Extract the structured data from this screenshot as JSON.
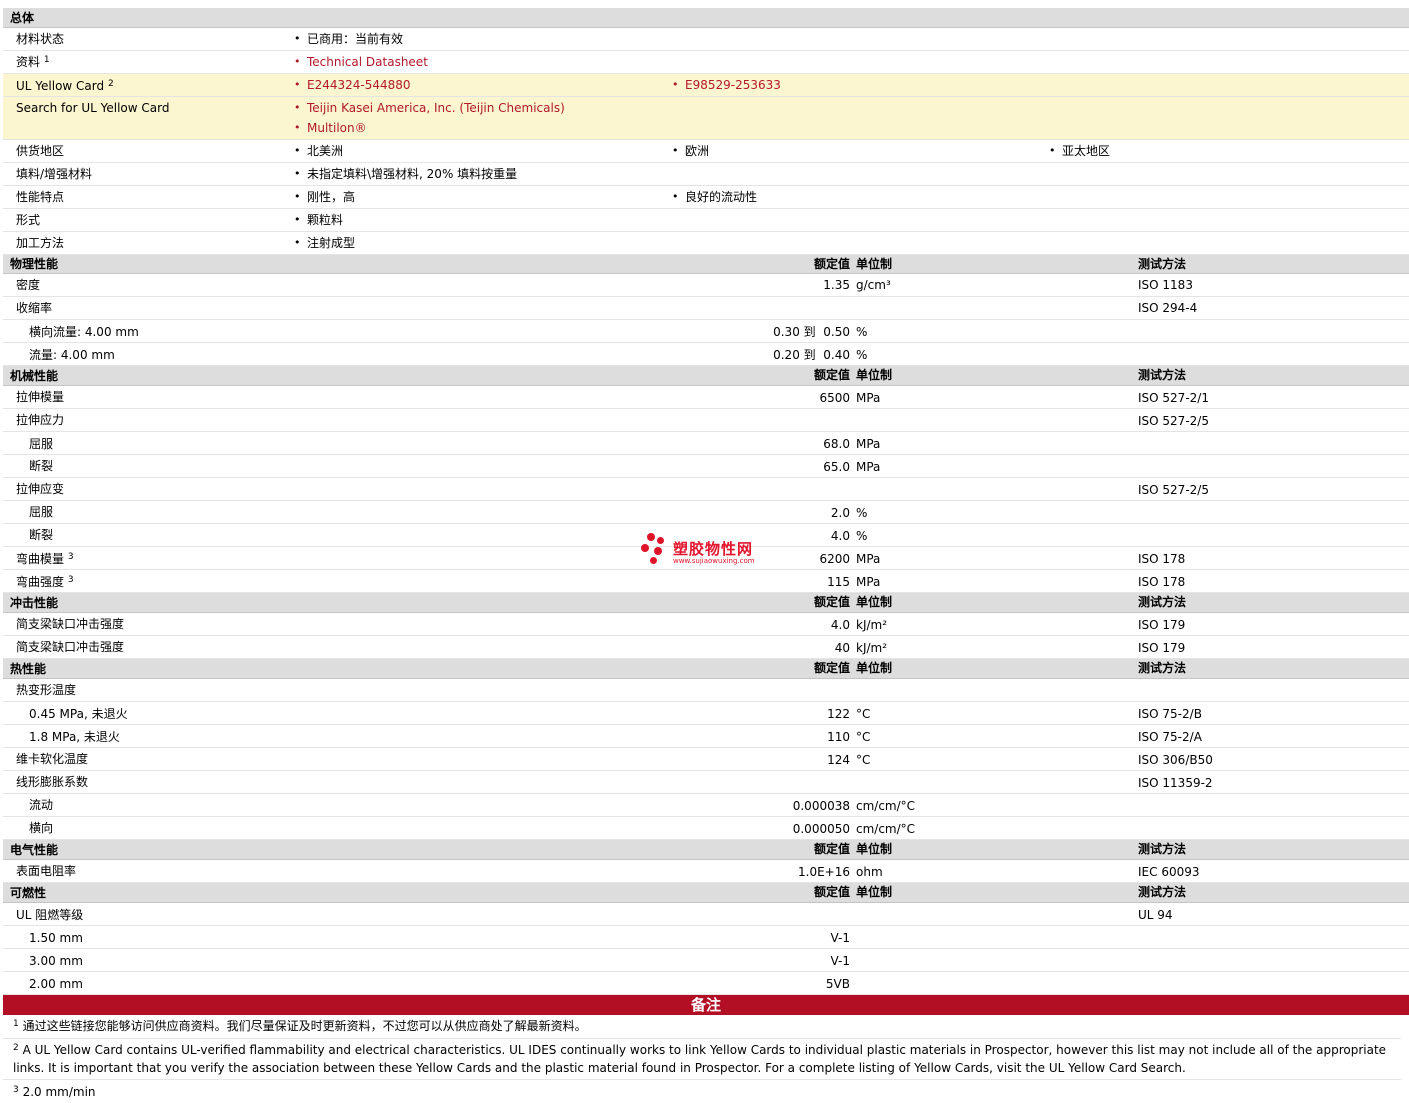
{
  "general": {
    "title": "总体",
    "status_label": "材料状态",
    "status_value": "已商用：当前有效",
    "docs_label": "资料",
    "docs_sup": "1",
    "docs_link": "Technical Datasheet",
    "ulcard_label": "UL Yellow Card",
    "ulcard_sup": "2",
    "ulcard_links": [
      "E244324-544880",
      "E98529-253633"
    ],
    "search_label": "Search for UL Yellow Card",
    "search_links": [
      "Teijin Kasei America, Inc. (Teijin Chemicals)",
      "Multilon®"
    ],
    "region_label": "供货地区",
    "regions": [
      "北美洲",
      "欧洲",
      "亚太地区"
    ],
    "filler_label": "填料/增强材料",
    "filler_value": "未指定填料\\增强材料, 20% 填料按重量",
    "features_label": "性能特点",
    "features": [
      "刚性，高",
      "良好的流动性"
    ],
    "form_label": "形式",
    "form_value": "颗粒料",
    "process_label": "加工方法",
    "process_value": "注射成型"
  },
  "headers": {
    "nominal": "额定值",
    "unit": "单位制",
    "method": "测试方法"
  },
  "physical": {
    "title": "物理性能",
    "rows": [
      {
        "label": "密度",
        "value": "1.35",
        "unit": "g/cm³",
        "method": "ISO 1183"
      },
      {
        "label": "收缩率",
        "value": "",
        "unit": "",
        "method": "ISO 294-4"
      },
      {
        "label": "横向流量: 4.00 mm",
        "value": "0.30 到  0.50",
        "unit": "%",
        "method": ""
      },
      {
        "label": "流量: 4.00 mm",
        "value": "0.20 到  0.40",
        "unit": "%",
        "method": ""
      }
    ]
  },
  "mechanical": {
    "title": "机械性能",
    "rows": [
      {
        "label": "拉伸模量",
        "value": "6500",
        "unit": "MPa",
        "method": "ISO 527-2/1"
      },
      {
        "label": "拉伸应力",
        "value": "",
        "unit": "",
        "method": "ISO 527-2/5"
      },
      {
        "label": "屈服",
        "value": "68.0",
        "unit": "MPa",
        "method": ""
      },
      {
        "label": "断裂",
        "value": "65.0",
        "unit": "MPa",
        "method": ""
      },
      {
        "label": "拉伸应变",
        "value": "",
        "unit": "",
        "method": "ISO 527-2/5"
      },
      {
        "label": "屈服",
        "value": "2.0",
        "unit": "%",
        "method": ""
      },
      {
        "label": "断裂",
        "value": "4.0",
        "unit": "%",
        "method": ""
      },
      {
        "label": "弯曲模量",
        "sup": "3",
        "value": "6200",
        "unit": "MPa",
        "method": "ISO 178"
      },
      {
        "label": "弯曲强度",
        "sup": "3",
        "value": "115",
        "unit": "MPa",
        "method": "ISO 178"
      }
    ]
  },
  "impact": {
    "title": "冲击性能",
    "rows": [
      {
        "label": "简支梁缺口冲击强度",
        "value": "4.0",
        "unit": "kJ/m²",
        "method": "ISO 179"
      },
      {
        "label": "简支梁缺口冲击强度",
        "value": "40",
        "unit": "kJ/m²",
        "method": "ISO 179"
      }
    ]
  },
  "thermal": {
    "title": "热性能",
    "rows": [
      {
        "label": "热变形温度",
        "value": "",
        "unit": "",
        "method": ""
      },
      {
        "label": "0.45 MPa, 未退火",
        "value": "122",
        "unit": "°C",
        "method": "ISO 75-2/B"
      },
      {
        "label": "1.8 MPa, 未退火",
        "value": "110",
        "unit": "°C",
        "method": "ISO 75-2/A"
      },
      {
        "label": "维卡软化温度",
        "value": "124",
        "unit": "°C",
        "method": "ISO 306/B50"
      },
      {
        "label": "线形膨胀系数",
        "value": "",
        "unit": "",
        "method": "ISO 11359-2"
      },
      {
        "label": "流动",
        "value": "0.000038",
        "unit": "cm/cm/°C",
        "method": ""
      },
      {
        "label": "横向",
        "value": "0.000050",
        "unit": "cm/cm/°C",
        "method": ""
      }
    ]
  },
  "electrical": {
    "title": "电气性能",
    "rows": [
      {
        "label": "表面电阻率",
        "value": "1.0E+16",
        "unit": "ohm",
        "method": "IEC 60093"
      }
    ]
  },
  "flammability": {
    "title": "可燃性",
    "rows": [
      {
        "label": "UL 阻燃等级",
        "value": "",
        "unit": "",
        "method": "UL 94"
      },
      {
        "label": "1.50 mm",
        "value": "V-1",
        "unit": "",
        "method": ""
      },
      {
        "label": "3.00 mm",
        "value": "V-1",
        "unit": "",
        "method": ""
      },
      {
        "label": "2.00 mm",
        "value": "5VB",
        "unit": "",
        "method": ""
      }
    ]
  },
  "notes": {
    "title": "备注",
    "items": [
      {
        "num": "1",
        "text": "通过这些链接您能够访问供应商资料。我们尽量保证及时更新资料，不过您可以从供应商处了解最新资料。"
      },
      {
        "num": "2",
        "text": "A UL Yellow Card contains UL-verified flammability and electrical characteristics. UL IDES continually works to link Yellow Cards to individual plastic materials in Prospector, however this list may not include all of the appropriate links. It is important that you verify the association between these Yellow Cards and the plastic material found in Prospector. For a complete listing of Yellow Cards, visit the UL Yellow Card Search."
      },
      {
        "num": "3",
        "text": "2.0 mm/min"
      }
    ]
  },
  "watermark": {
    "name": "塑胶物性网",
    "url": "www.sujiaowuxing.com",
    "color": "#e01428"
  },
  "colors": {
    "section_bg": "#dddddd",
    "highlight_bg": "#fbf6cf",
    "link": "#b3182b",
    "notes_bar": "#b20f24"
  }
}
